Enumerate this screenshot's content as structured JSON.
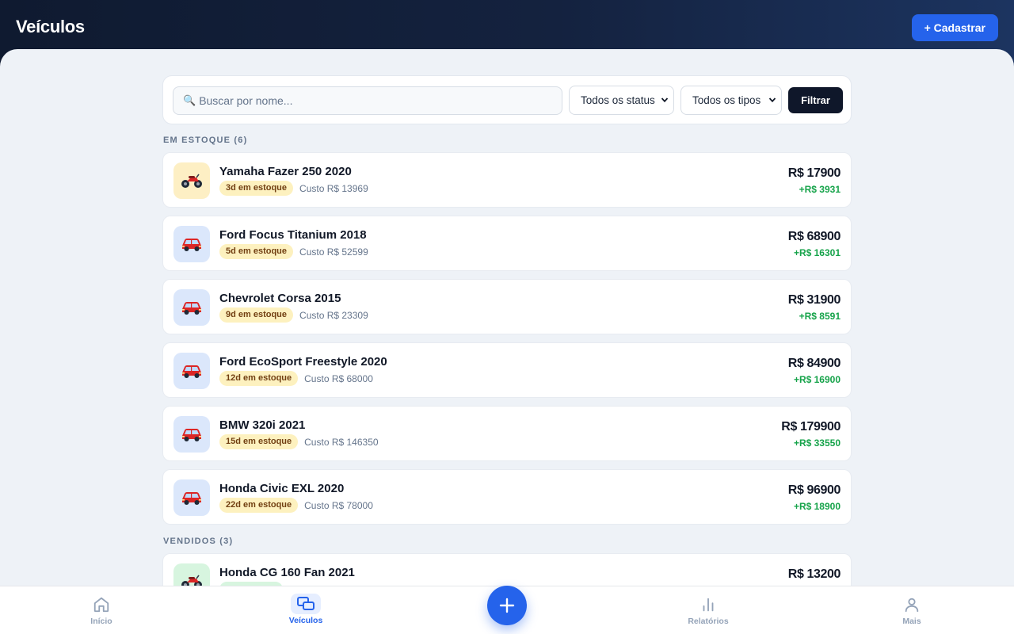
{
  "header": {
    "title": "Veículos",
    "add_button": "+ Cadastrar"
  },
  "filters": {
    "search_placeholder": "Buscar por nome...",
    "status_select": "Todos os status",
    "type_select": "Todos os tipos",
    "filter_button": "Filtrar"
  },
  "sections": {
    "in_stock_title": "EM ESTOQUE (6)",
    "sold_title": "VENDIDOS (3)"
  },
  "vehicles": [
    {
      "type": "moto",
      "icon": "motorcycle-icon",
      "name": "Yamaha Fazer 250 2020",
      "badge": "3d em estoque",
      "cost": "Custo R$ 13969",
      "price": "R$ 17900",
      "profit": "+R$ 3931"
    },
    {
      "type": "car",
      "icon": "car-icon",
      "name": "Ford Focus Titanium 2018",
      "badge": "5d em estoque",
      "cost": "Custo R$ 52599",
      "price": "R$ 68900",
      "profit": "+R$ 16301"
    },
    {
      "type": "car",
      "icon": "car-icon",
      "name": "Chevrolet Corsa 2015",
      "badge": "9d em estoque",
      "cost": "Custo R$ 23309",
      "price": "R$ 31900",
      "profit": "+R$ 8591"
    },
    {
      "type": "car",
      "icon": "car-icon",
      "name": "Ford EcoSport Freestyle 2020",
      "badge": "12d em estoque",
      "cost": "Custo R$ 68000",
      "price": "R$ 84900",
      "profit": "+R$ 16900"
    },
    {
      "type": "car",
      "icon": "car-icon",
      "name": "BMW 320i 2021",
      "badge": "15d em estoque",
      "cost": "Custo R$ 146350",
      "price": "R$ 179900",
      "profit": "+R$ 33550"
    },
    {
      "type": "car",
      "icon": "car-icon",
      "name": "Honda Civic EXL 2020",
      "badge": "22d em estoque",
      "cost": "Custo R$ 78000",
      "price": "R$ 96900",
      "profit": "+R$ 18900"
    }
  ],
  "sold": [
    {
      "type": "moto",
      "icon": "motorcycle-icon",
      "name": "Honda CG 160 Fan 2021",
      "price": "R$ 13200"
    }
  ],
  "nav": {
    "home": "Início",
    "vehicles": "Veículos",
    "reports": "Relatórios",
    "more": "Mais"
  },
  "colors": {
    "accent": "#2563eb",
    "profit": "#16a34a",
    "badge_bg": "#fdf1bf",
    "header_dark": "#0f1a30"
  }
}
